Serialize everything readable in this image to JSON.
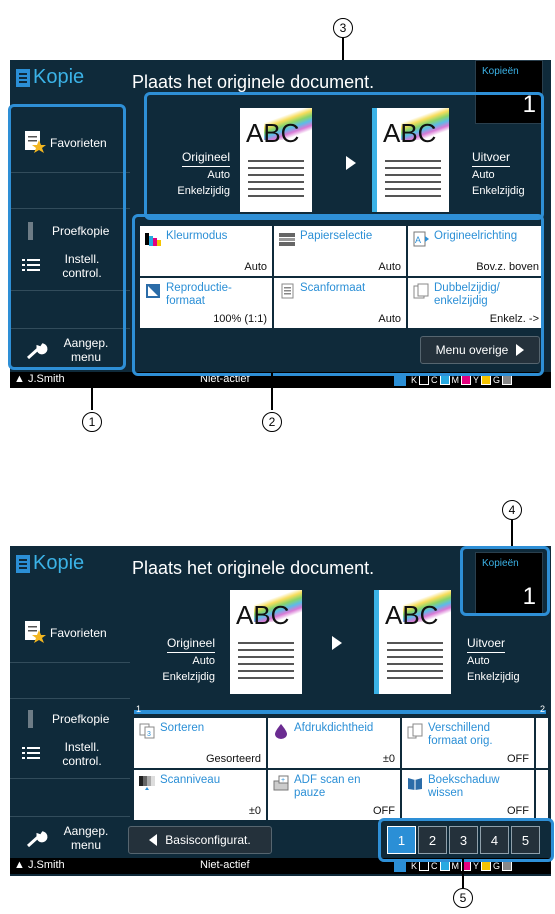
{
  "screen1": {
    "app_title": "Kopie",
    "message": "Plaats het originele document.",
    "copies_label": "Kopieën",
    "copies_value": "1",
    "sidebar": [
      "Favorieten",
      "Proefkopie",
      "Instell. control.",
      "Aangep. menu"
    ],
    "original": {
      "label": "Origineel",
      "v1": "Auto",
      "v2": "Enkelzijdig"
    },
    "output": {
      "label": "Uitvoer",
      "v1": "Auto",
      "v2": "Enkelzijdig"
    },
    "page_text": "ABC",
    "tiles": [
      {
        "name": "Kleurmodus",
        "value": "Auto"
      },
      {
        "name": "Papierselectie",
        "value": "Auto"
      },
      {
        "name": "Origineelrichting",
        "value": "Bov.z. boven"
      },
      {
        "name": "Reproductie- formaat",
        "value": "100% (1:1)"
      },
      {
        "name": "Scanformaat",
        "value": "Auto"
      },
      {
        "name": "Dubbelzijdig/ enkelzijdig",
        "value": "Enkelz. ->"
      }
    ],
    "menu_button": "Menu overige",
    "status": {
      "user": "J.Smith",
      "state": "Niet-actief",
      "inks": [
        "K",
        "C",
        "M",
        "Y",
        "G"
      ]
    },
    "callouts": [
      "1",
      "2",
      "3"
    ]
  },
  "screen2": {
    "app_title": "Kopie",
    "message": "Plaats het originele document.",
    "copies_label": "Kopieën",
    "copies_value": "1",
    "sidebar": [
      "Favorieten",
      "Proefkopie",
      "Instell. control.",
      "Aangep. menu"
    ],
    "original": {
      "label": "Origineel",
      "v1": "Auto",
      "v2": "Enkelzijdig"
    },
    "output": {
      "label": "Uitvoer",
      "v1": "Auto",
      "v2": "Enkelzijdig"
    },
    "page_text": "ABC",
    "tab_markers": [
      "1",
      "2"
    ],
    "tiles": [
      {
        "name": "Sorteren",
        "value": "Gesorteerd"
      },
      {
        "name": "Afdrukdichtheid",
        "value": "±0"
      },
      {
        "name": "Verschillend formaat orig.",
        "value": "OFF"
      },
      {
        "name": "Scanniveau",
        "value": "±0"
      },
      {
        "name": "ADF scan en pauze",
        "value": "OFF"
      },
      {
        "name": "Boekschaduw wissen",
        "value": "OFF"
      }
    ],
    "back_button": "Basisconfigurat.",
    "pages": [
      "1",
      "2",
      "3",
      "4",
      "5"
    ],
    "status": {
      "user": "J.Smith",
      "state": "Niet-actief",
      "inks": [
        "K",
        "C",
        "M",
        "Y",
        "G"
      ]
    },
    "callouts": [
      "4",
      "5"
    ]
  }
}
